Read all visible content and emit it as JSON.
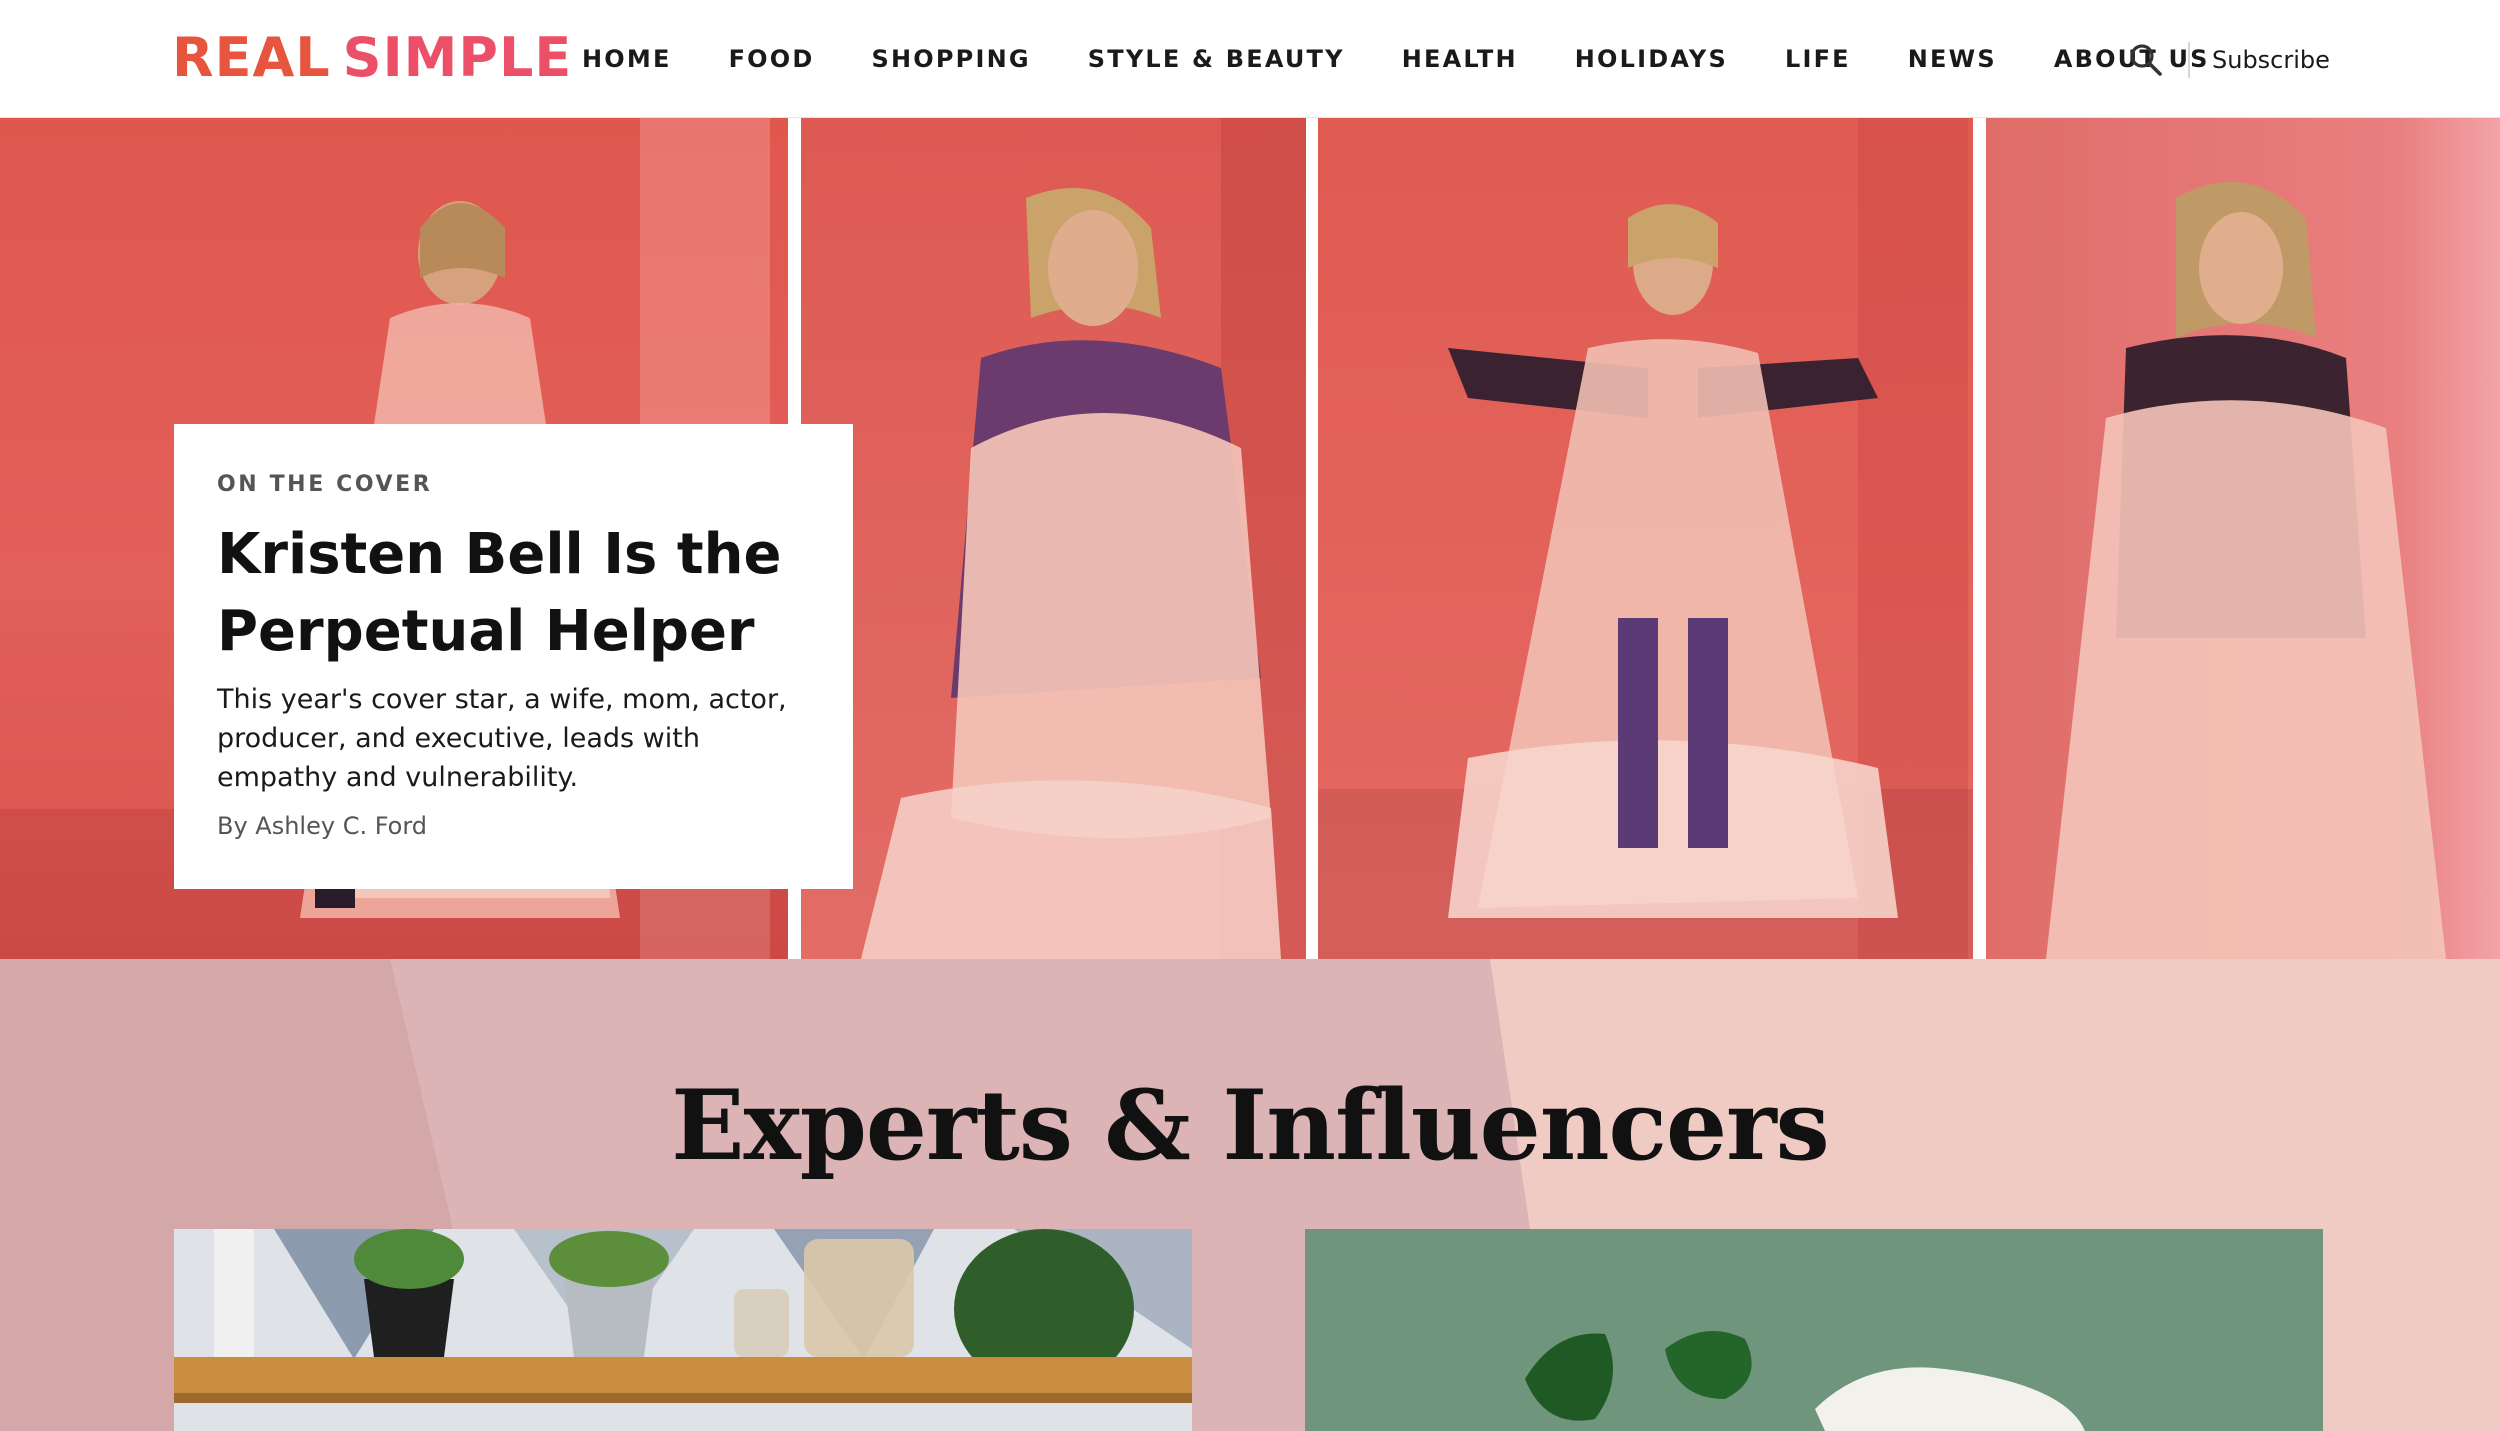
{
  "header": {
    "logo": {
      "part1": "REAL",
      "part2": "SIMPLE"
    },
    "nav": [
      "HOME",
      "FOOD",
      "SHOPPING",
      "STYLE & BEAUTY",
      "HEALTH",
      "HOLIDAYS",
      "LIFE",
      "NEWS",
      "ABOUT US"
    ],
    "search_icon": "search-icon",
    "subscribe_label": "Subscribe"
  },
  "hero": {
    "eyebrow": "ON THE COVER",
    "title": "Kristen Bell Is the Perpetual Helper",
    "dek": "This year's cover star, a wife, mom, actor, producer, and executive, leads with empathy and vulnerability.",
    "byline": "By Ashley C. Ford"
  },
  "experts": {
    "heading": "Experts & Influencers"
  },
  "colors": {
    "logo_real": "#e8553f",
    "logo_simple": "#ec4f68",
    "hero_red": "#e05b52",
    "section_pink": "#d4a7a9",
    "section_peach": "#f0cbc3",
    "tile_green": "#6f967c"
  }
}
